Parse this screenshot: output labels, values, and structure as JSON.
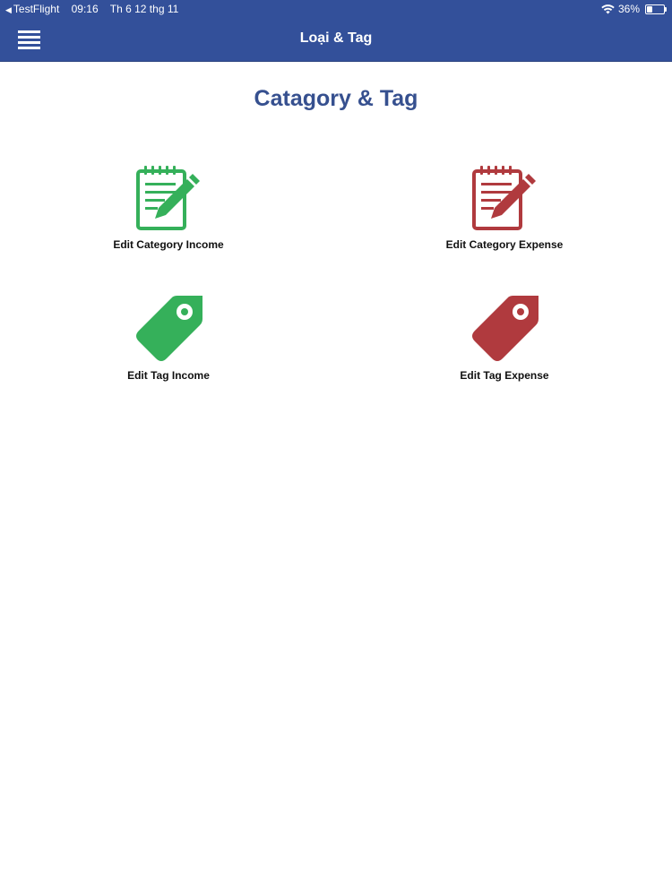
{
  "status_bar": {
    "back_app": "TestFlight",
    "time": "09:16",
    "date": "Th 6 12 thg 11",
    "battery": "36%",
    "battery_level": 0.36
  },
  "nav": {
    "title": "Loại & Tag"
  },
  "page": {
    "title": "Catagory & Tag"
  },
  "colors": {
    "header": "#33509a",
    "income": "#35b05a",
    "expense": "#b03a3e",
    "title": "#36508f"
  },
  "tiles": [
    {
      "label": "Edit Category Income",
      "icon": "notepad-pencil-icon",
      "color": "#35b05a"
    },
    {
      "label": "Edit Category Expense",
      "icon": "notepad-pencil-icon",
      "color": "#b03a3e"
    },
    {
      "label": "Edit Tag Income",
      "icon": "price-tag-icon",
      "color": "#35b05a"
    },
    {
      "label": "Edit Tag Expense",
      "icon": "price-tag-icon",
      "color": "#b03a3e"
    }
  ]
}
